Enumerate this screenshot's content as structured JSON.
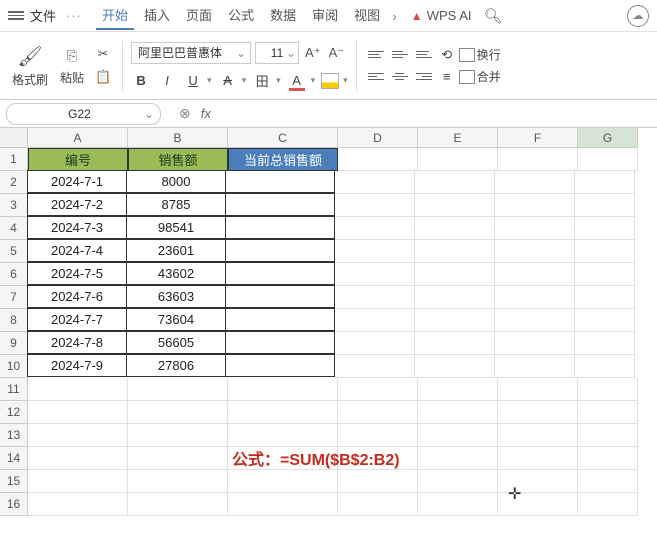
{
  "topbar": {
    "file_label": "文件",
    "wps_ai_label": "WPS AI"
  },
  "tabs": {
    "items": [
      "开始",
      "插入",
      "页面",
      "公式",
      "数据",
      "审阅",
      "视图"
    ],
    "active_index": 0
  },
  "ribbon": {
    "format_brush": "格式刷",
    "paste": "粘贴",
    "font_name": "阿里巴巴普惠体",
    "font_size": "11",
    "wrap_label": "换行",
    "merge_label": "合并"
  },
  "namebox": {
    "cell_ref": "G22"
  },
  "columns": [
    "A",
    "B",
    "C",
    "D",
    "E",
    "F",
    "G"
  ],
  "row_numbers": [
    1,
    2,
    3,
    4,
    5,
    6,
    7,
    8,
    9,
    10,
    11,
    12,
    13,
    14,
    15,
    16
  ],
  "headers": {
    "col_a": "编号",
    "col_b": "销售额",
    "col_c": "当前总销售额"
  },
  "data_rows": [
    {
      "a": "2024-7-1",
      "b": "8000"
    },
    {
      "a": "2024-7-2",
      "b": "8785"
    },
    {
      "a": "2024-7-3",
      "b": "98541"
    },
    {
      "a": "2024-7-4",
      "b": "23601"
    },
    {
      "a": "2024-7-5",
      "b": "43602"
    },
    {
      "a": "2024-7-6",
      "b": "63603"
    },
    {
      "a": "2024-7-7",
      "b": "73604"
    },
    {
      "a": "2024-7-8",
      "b": "56605"
    },
    {
      "a": "2024-7-9",
      "b": "27806"
    }
  ],
  "formula_annotation": "公式：=SUM($B$2:B2)"
}
